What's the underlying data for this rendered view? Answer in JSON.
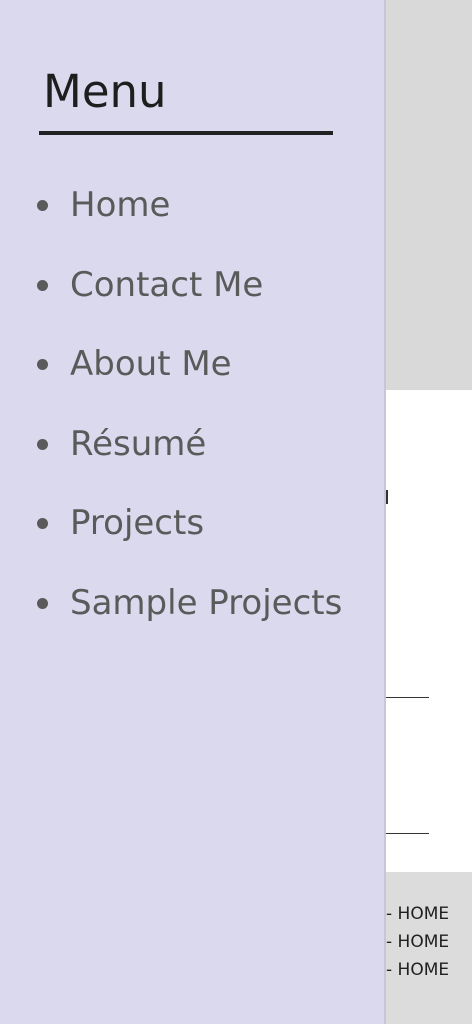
{
  "menu": {
    "title": "Menu",
    "items": [
      {
        "label": "Home"
      },
      {
        "label": "Contact Me"
      },
      {
        "label": "About Me"
      },
      {
        "label": "Résumé"
      },
      {
        "label": "Projects"
      },
      {
        "label": "Sample Projects"
      }
    ]
  },
  "footer": {
    "links": [
      {
        "label": "- HOME"
      },
      {
        "label": "- HOME"
      },
      {
        "label": "- HOME"
      }
    ]
  },
  "colors": {
    "menu_background": "#dbd9ee",
    "hero_background": "#d9d9d9",
    "footer_background": "#dcdcdc",
    "menu_text": "#5a5a5a",
    "title_text": "#1e1e1e"
  }
}
